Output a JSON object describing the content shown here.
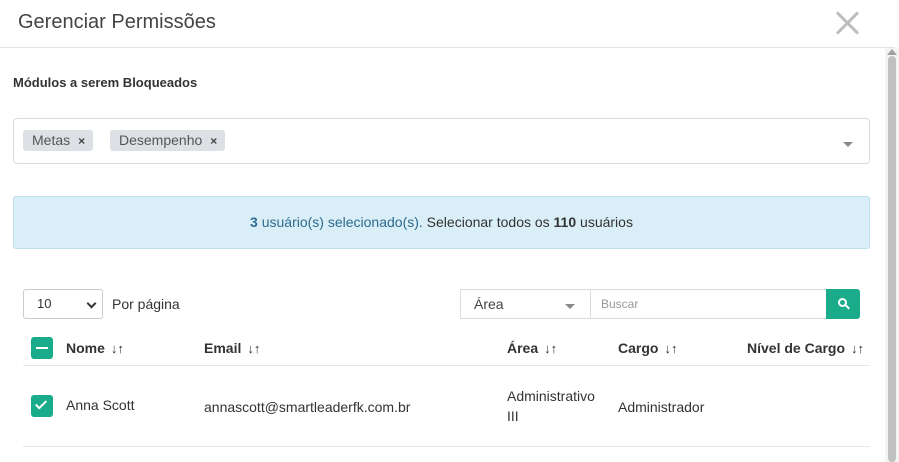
{
  "modal": {
    "title": "Gerenciar Permissões",
    "close_icon": "close-icon"
  },
  "modules": {
    "label": "Módulos a serem Bloqueados",
    "tags": [
      {
        "label": "Metas",
        "remove": "×"
      },
      {
        "label": "Desempenho",
        "remove": "×"
      }
    ]
  },
  "selection_alert": {
    "count": "3",
    "selected_text": " usuário(s) selecionado(s).",
    "select_all_prefix": " Selecionar todos os ",
    "total": "110",
    "select_all_suffix": " usuários"
  },
  "toolbar": {
    "per_page_value": "10",
    "per_page_label": "Por página",
    "filter_field": "Área",
    "search_placeholder": "Buscar"
  },
  "table": {
    "columns": [
      "Nome",
      "Email",
      "Área",
      "Cargo",
      "Nível de Cargo"
    ],
    "sort_icon": "↓↑",
    "rows": [
      {
        "checked": true,
        "nome": "Anna Scott",
        "email": "annascott@smartleaderfk.com.br",
        "area": "Administrativo III",
        "cargo": "Administrador",
        "nivel": ""
      }
    ]
  },
  "colors": {
    "accent": "#1aab8a",
    "alert_bg": "#d9eef7",
    "tag_bg": "#dde1e6"
  }
}
